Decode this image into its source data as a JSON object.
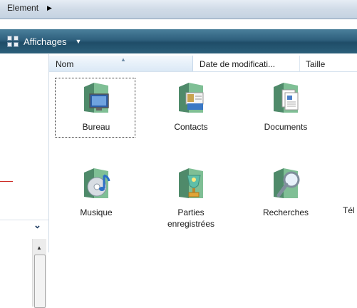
{
  "breadcrumb": {
    "text": "Element",
    "arrow": "▶"
  },
  "toolbar": {
    "views_label": "Affichages",
    "views_caret": "▼"
  },
  "columns": {
    "name": "Nom",
    "date": "Date de modificati...",
    "size": "Taille"
  },
  "nav": {
    "chevron": "⌄",
    "scroll_up": "▲"
  },
  "items": [
    {
      "label": "Bureau"
    },
    {
      "label": "Contacts"
    },
    {
      "label": "Documents"
    },
    {
      "label": "Musique"
    },
    {
      "label": "Parties\nenregistrées"
    },
    {
      "label": "Recherches"
    },
    {
      "label": "Tél"
    }
  ],
  "colors": {
    "toolbar": "#2e5f7c",
    "folder": "#5fa37b",
    "selection_border": "#333333"
  }
}
